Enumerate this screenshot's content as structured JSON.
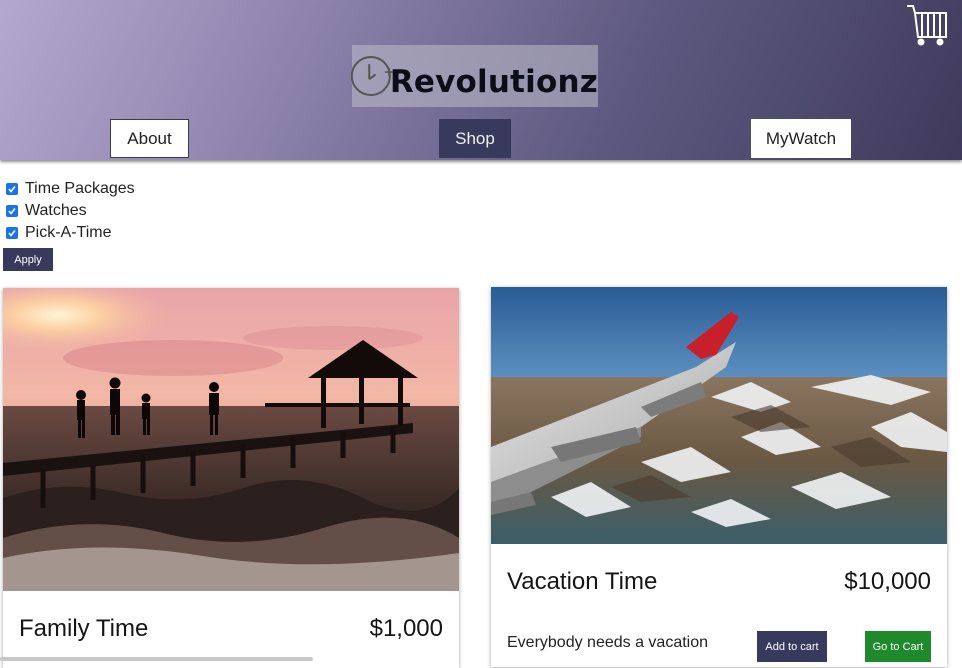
{
  "header": {
    "brand_name": "Revolutionz",
    "nav": {
      "about": "About",
      "shop": "Shop",
      "mywatch": "MyWatch"
    },
    "cart_icon": "shopping-cart-icon",
    "logo_icon": "clock-plus-icon"
  },
  "filters": {
    "items": [
      {
        "label": "Time Packages",
        "checked": true
      },
      {
        "label": "Watches",
        "checked": true
      },
      {
        "label": "Pick-A-Time",
        "checked": true
      }
    ],
    "apply_label": "Apply"
  },
  "products": [
    {
      "title": "Family Time",
      "price": "$1,000",
      "image": "beach-pier-sunset"
    },
    {
      "title": "Vacation Time",
      "price": "$10,000",
      "image": "airplane-wing-over-mountains",
      "description": "Everybody needs a vacation",
      "add_to_cart_label": "Add to cart",
      "go_to_cart_label": "Go to Cart"
    }
  ],
  "colors": {
    "accent": "#383a5d",
    "checkbox": "#1a73e8",
    "go_cart": "#1f8a2c"
  }
}
